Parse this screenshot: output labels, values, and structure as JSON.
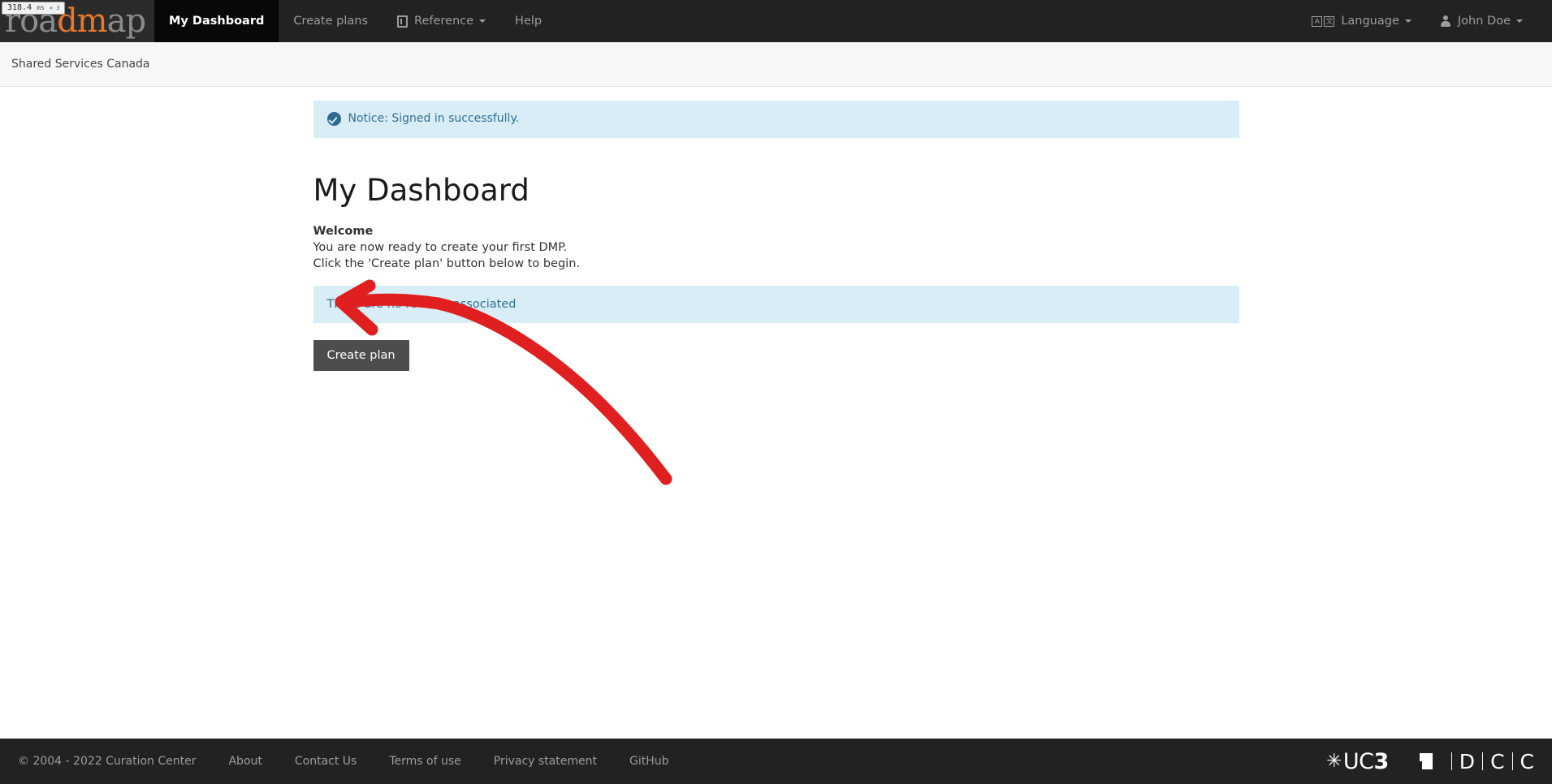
{
  "perf_badge": {
    "time": "318.4",
    "unit": "ms",
    "multiplier": "× 3"
  },
  "navbar": {
    "brand": {
      "part1": "roa",
      "part2": "dm",
      "part3": "ap",
      "full": "roadmap"
    },
    "items": [
      {
        "label": "My Dashboard",
        "active": true,
        "icon": ""
      },
      {
        "label": "Create plans",
        "active": false,
        "icon": ""
      },
      {
        "label": "Reference",
        "active": false,
        "icon": "book-icon",
        "caret": true
      },
      {
        "label": "Help",
        "active": false,
        "icon": ""
      }
    ],
    "right": {
      "language_label": "Language",
      "language_icon": "translate-icon",
      "language_icon_glyphs": [
        "A",
        "文"
      ],
      "user_label": "John Doe",
      "user_icon": "user-icon"
    }
  },
  "subheader": {
    "organization": "Shared Services Canada"
  },
  "main": {
    "notice": {
      "icon": "check-circle-icon",
      "text": "Notice: Signed in successfully."
    },
    "page_title": "My Dashboard",
    "welcome_heading": "Welcome",
    "welcome_lines": [
      "You are now ready to create your first DMP.",
      "Click the 'Create plan' button below to begin."
    ],
    "records_panel_text": "There are no records associated",
    "create_plan_label": "Create plan"
  },
  "annotation": {
    "type": "hand-drawn-arrow",
    "color": "#e02020",
    "points_to": "create-plan-button"
  },
  "footer": {
    "copyright": "© 2004 - 2022 Curation Center",
    "links": [
      {
        "label": "About"
      },
      {
        "label": "Contact Us"
      },
      {
        "label": "Terms of use"
      },
      {
        "label": "Privacy statement"
      },
      {
        "label": "GitHub"
      }
    ],
    "logos": {
      "uc3_burst": "✳",
      "uc3_uc": "UC",
      "uc3_three": "3",
      "dcc_d": "D",
      "dcc_c1": "C",
      "dcc_c2": "C"
    }
  },
  "colors": {
    "navbar_bg": "#222222",
    "brand_accent": "#e8762c",
    "alert_bg": "#d9edf7",
    "alert_text": "#31708f",
    "button_bg": "#4d4d4d",
    "annotation_red": "#e02020"
  }
}
